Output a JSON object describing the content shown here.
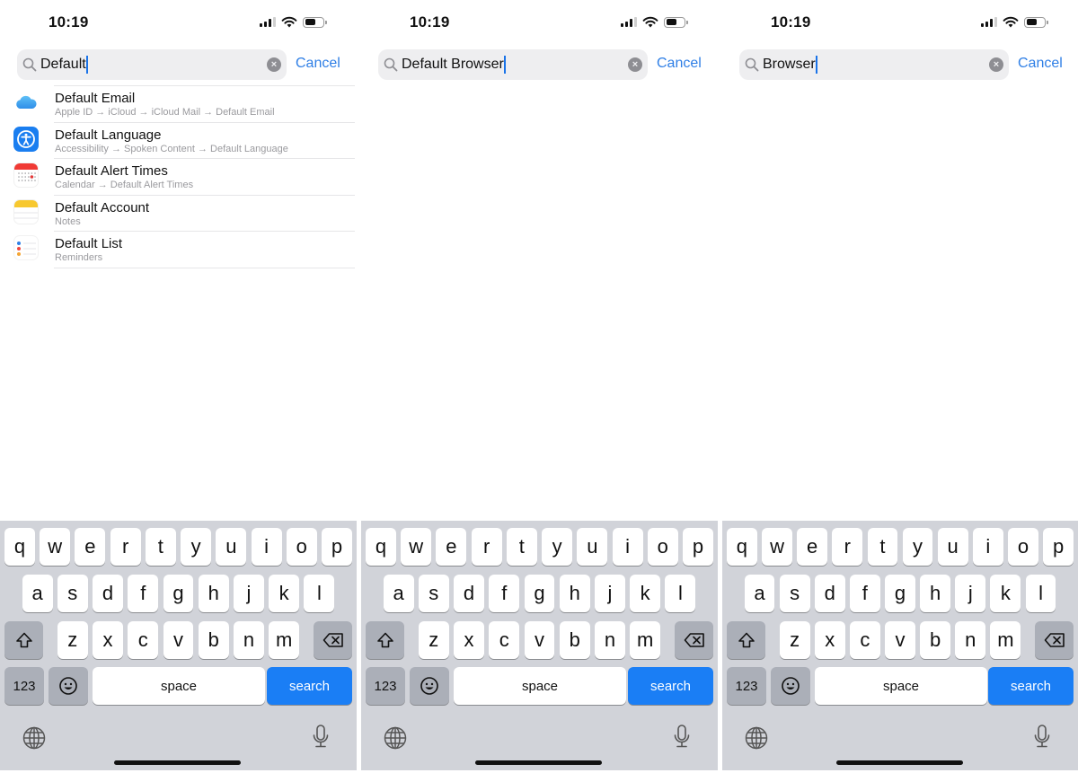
{
  "panels": [
    {
      "status": {
        "time": "10:19",
        "battery_level": 0.6
      },
      "search": {
        "query": "Default",
        "cancel_label": "Cancel"
      },
      "results": [
        {
          "icon": "icloud-icon",
          "title": "Default Email",
          "path": "Apple ID → iCloud → iCloud Mail → Default Email"
        },
        {
          "icon": "accessibility-icon",
          "title": "Default Language",
          "path": "Accessibility → Spoken Content → Default Language"
        },
        {
          "icon": "calendar-icon",
          "title": "Default Alert Times",
          "path": "Calendar → Default Alert Times"
        },
        {
          "icon": "notes-icon",
          "title": "Default Account",
          "path": "Notes"
        },
        {
          "icon": "reminders-icon",
          "title": "Default List",
          "path": "Reminders"
        }
      ]
    },
    {
      "status": {
        "time": "10:19",
        "battery_level": 0.6
      },
      "search": {
        "query": "Default Browser",
        "cancel_label": "Cancel"
      },
      "results": []
    },
    {
      "status": {
        "time": "10:19",
        "battery_level": 0.6
      },
      "search": {
        "query": "Browser",
        "cancel_label": "Cancel"
      },
      "results": []
    }
  ],
  "keyboard": {
    "row1": [
      "q",
      "w",
      "e",
      "r",
      "t",
      "y",
      "u",
      "i",
      "o",
      "p"
    ],
    "row2": [
      "a",
      "s",
      "d",
      "f",
      "g",
      "h",
      "j",
      "k",
      "l"
    ],
    "row3": [
      "z",
      "x",
      "c",
      "v",
      "b",
      "n",
      "m"
    ],
    "numbers_label": "123",
    "space_label": "space",
    "search_label": "search"
  },
  "colors": {
    "accent": "#2f7fe6",
    "search_key": "#1a7ef5",
    "keyboard_bg": "#d1d3d9"
  }
}
